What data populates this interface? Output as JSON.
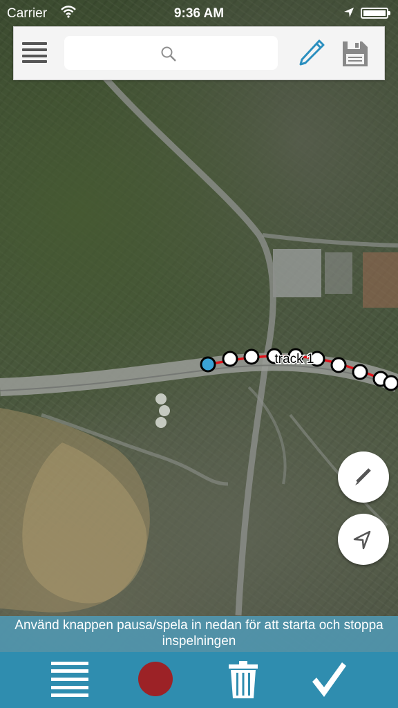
{
  "status_bar": {
    "carrier": "Carrier",
    "time": "9:36 AM"
  },
  "toolbar": {
    "search_placeholder": "",
    "search_value": "",
    "icons": [
      "menu-icon",
      "search-icon",
      "pencil-icon",
      "save-icon"
    ]
  },
  "map": {
    "track_label": "track 1",
    "track_color": "#e0141b",
    "road_color": "#8c8f8b"
  },
  "floating_buttons": {
    "icons": [
      "edit-icon",
      "navigation-arrow-icon"
    ]
  },
  "banner": {
    "text": "Använd knappen pausa/spela in nedan för att starta och stoppa inspelningen"
  },
  "bottom_bar": {
    "icons": [
      "list-icon",
      "record-icon",
      "trash-icon",
      "checkmark-icon"
    ],
    "background": "#2f8daf",
    "record_color": "#9c2226"
  }
}
